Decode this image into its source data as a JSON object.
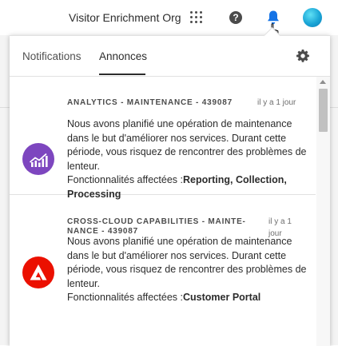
{
  "header": {
    "org_name": "Visitor Enrichment Org",
    "icons": [
      "apps-grid-icon",
      "help-icon",
      "bell-icon",
      "avatar"
    ]
  },
  "tabs": [
    {
      "label": "Notifications",
      "active": false
    },
    {
      "label": "Annonces",
      "active": true
    }
  ],
  "settings_icon": "gear-icon",
  "announcements": [
    {
      "title": "ANALYTICS - MAINTENANCE - 439087",
      "time": "il y a 1 jour",
      "body": "Nous avons planifié une opération de maintenance dans le but d'améliorer nos services. Durant cette période, vous risquez de rencontrer des problèmes de lenteur.",
      "affected_label": "Fonctionnalités affectées :",
      "affected_value": "Reporting, Collection, Processing",
      "product_icon": "analytics-icon",
      "icon_color": "#7d46bf"
    },
    {
      "title_line1": "CROSS-CLOUD CAPABILITIES - MAINTE-",
      "title_line2": "NANCE - 439087",
      "time_line1": "il y a 1",
      "time_line2": "jour",
      "body": "Nous avons planifié une opération de maintenance dans le but d'améliorer nos services. Durant cette période, vous risquez de rencontrer des problèmes de lenteur.",
      "affected_label": "Fonctionnalités affectées :",
      "affected_value": "Customer Portal",
      "product_icon": "adobe-icon",
      "icon_color": "#eb1000"
    }
  ]
}
